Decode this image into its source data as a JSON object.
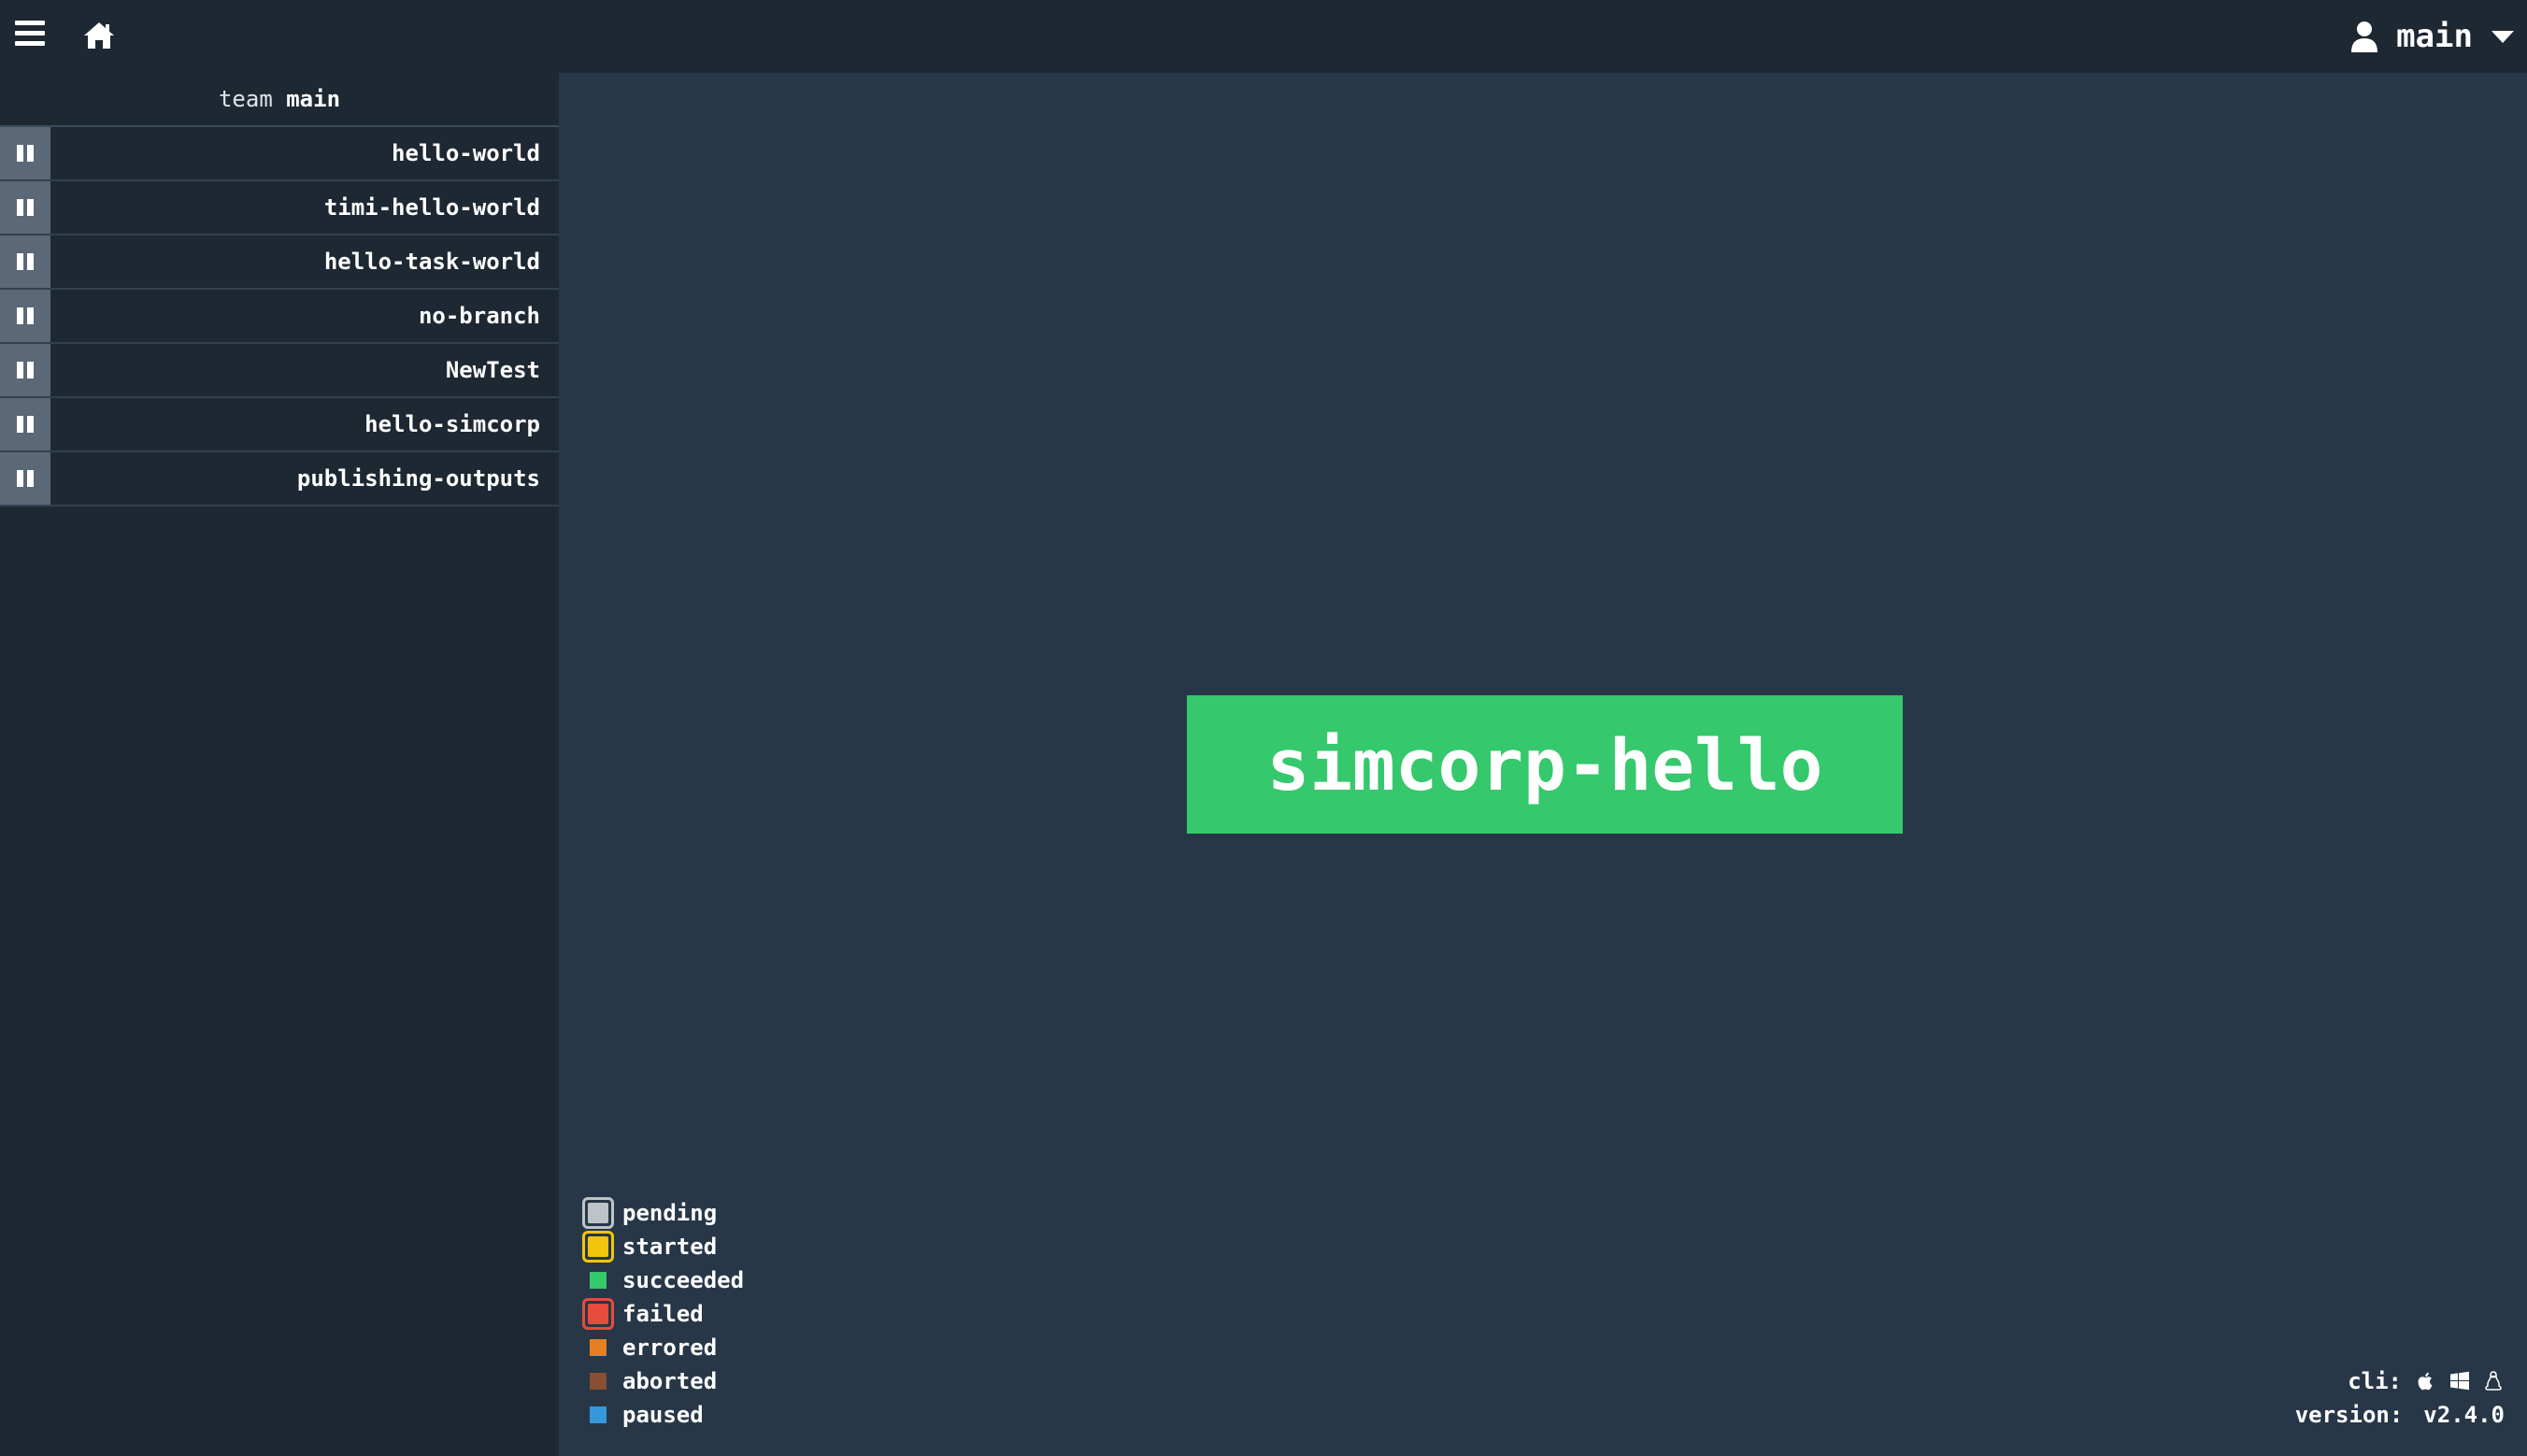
{
  "header": {
    "user_name": "main"
  },
  "sidebar": {
    "team_prefix": "team",
    "team_name": "main",
    "pipelines": [
      {
        "name": "hello-world"
      },
      {
        "name": "timi-hello-world"
      },
      {
        "name": "hello-task-world"
      },
      {
        "name": "no-branch"
      },
      {
        "name": "NewTest"
      },
      {
        "name": "hello-simcorp"
      },
      {
        "name": "publishing-outputs"
      }
    ]
  },
  "main": {
    "pipeline_job": "simcorp-hello",
    "pipeline_job_color": "#35c86c"
  },
  "legend": {
    "items": [
      {
        "label": "pending",
        "color": "#bec3c9",
        "bordered": true
      },
      {
        "label": "started",
        "color": "#f1c40f",
        "bordered": true
      },
      {
        "label": "succeeded",
        "color": "#35c86c",
        "bordered": false
      },
      {
        "label": "failed",
        "color": "#e74c3c",
        "bordered": true
      },
      {
        "label": "errored",
        "color": "#e67e22",
        "bordered": false
      },
      {
        "label": "aborted",
        "color": "#8b4e33",
        "bordered": false
      },
      {
        "label": "paused",
        "color": "#3498db",
        "bordered": false
      }
    ]
  },
  "footer": {
    "cli_label": "cli:",
    "cli_icons": [
      "apple-icon",
      "windows-icon",
      "linux-icon"
    ],
    "version_label": "version:",
    "version_value": "v2.4.0"
  }
}
